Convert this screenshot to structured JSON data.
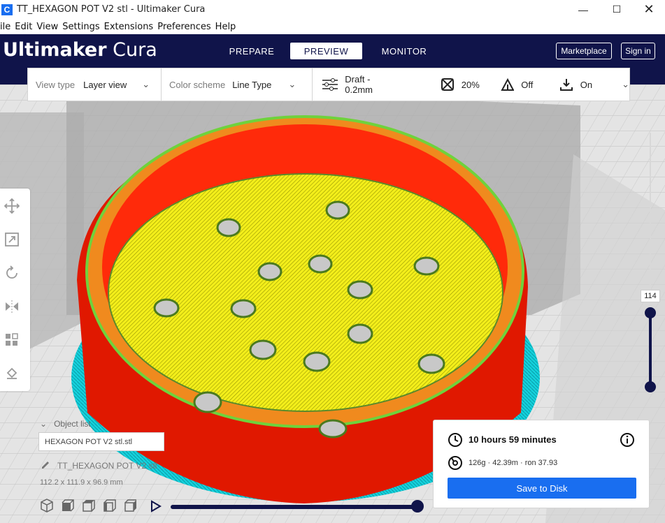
{
  "window": {
    "title": "TT_HEXAGON POT V2 stl - Ultimaker Cura",
    "app_icon_letter": "C"
  },
  "menu": [
    "ile",
    "Edit",
    "View",
    "Settings",
    "Extensions",
    "Preferences",
    "Help"
  ],
  "header": {
    "brand_bold": "Ultimaker",
    "brand_light": "Cura",
    "tabs": [
      {
        "label": "PREPARE",
        "active": false
      },
      {
        "label": "PREVIEW",
        "active": true
      },
      {
        "label": "MONITOR",
        "active": false
      }
    ],
    "marketplace_label": "Marketplace",
    "signin_label": "Sign in"
  },
  "toolbar": {
    "view_type_label": "View type",
    "view_type_value": "Layer view",
    "color_scheme_label": "Color scheme",
    "color_scheme_value": "Line Type",
    "profile": "Draft - 0.2mm",
    "infill": "20%",
    "support": "Off",
    "adhesion": "On"
  },
  "layer_slider": {
    "current_layer": "114"
  },
  "object_list": {
    "title": "Object list",
    "item": "HEXAGON POT V2 stl.stl",
    "object_name": "TT_HEXAGON POT V2 stl",
    "dimensions": "112.2 x 111.9 x 96.9 mm"
  },
  "print_info": {
    "time": "10 hours 59 minutes",
    "material": "126g · 42.39m · ron 37.93",
    "save_label": "Save to Disk"
  },
  "colors": {
    "header_bg": "#10144a",
    "accent": "#196ef0",
    "wall_red": "#ff1a00",
    "infill_yellow": "#f5f000",
    "skirt_cyan": "#14d2dc",
    "support_orange": "#f08a1e"
  },
  "icons": {
    "move": "move-icon",
    "scale": "scale-icon",
    "rotate": "rotate-icon",
    "mirror": "mirror-icon",
    "per_model": "per-model-settings-icon",
    "support_blocker": "support-blocker-icon"
  }
}
